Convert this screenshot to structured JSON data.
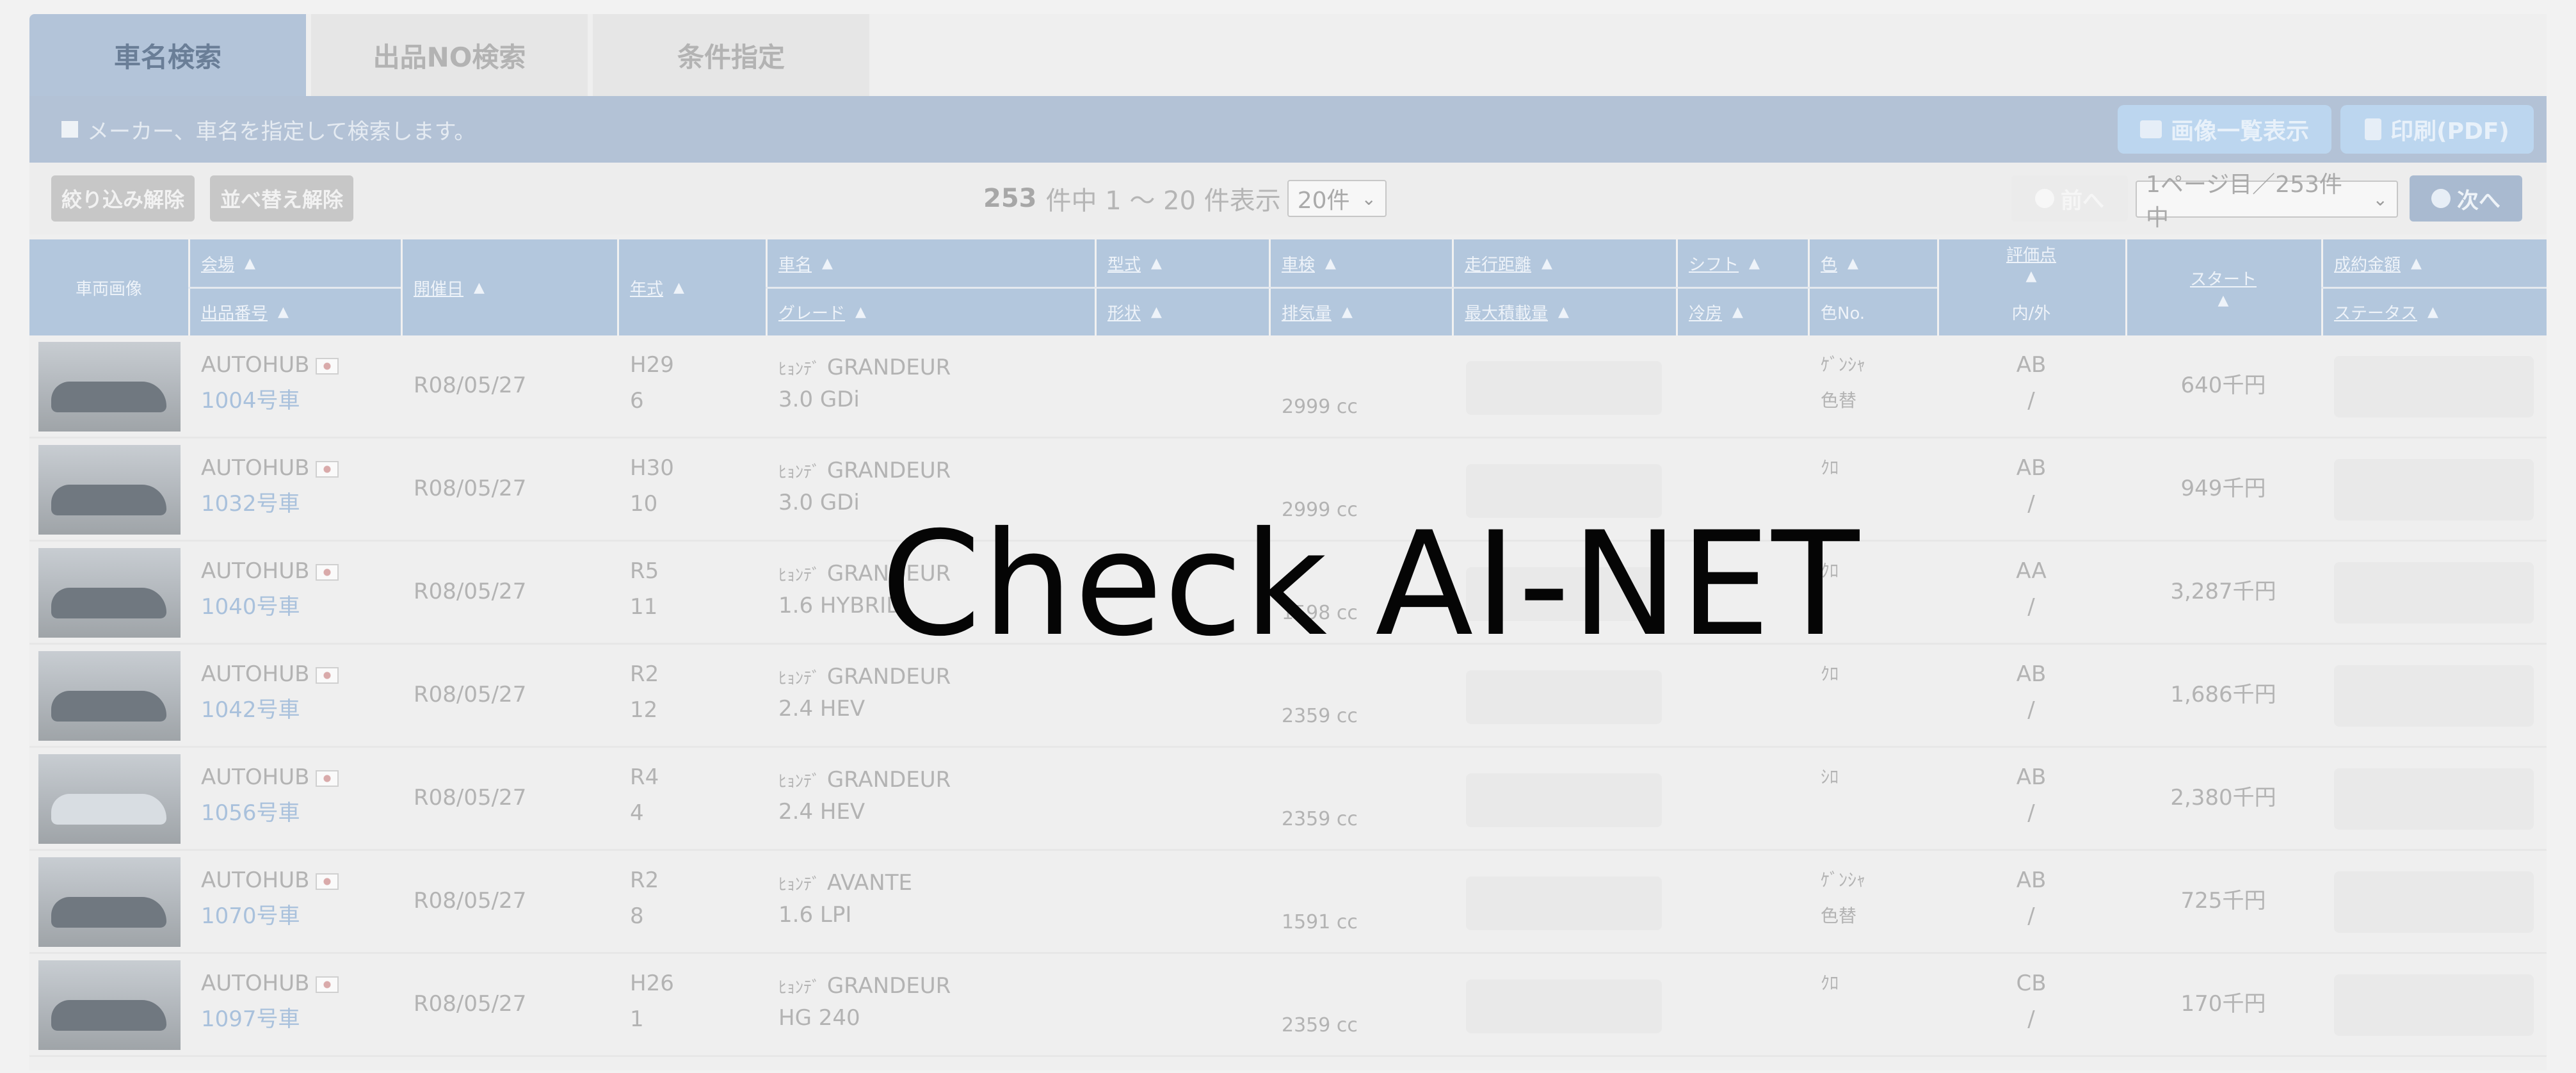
{
  "tabs": [
    {
      "label": "車名検索",
      "active": true
    },
    {
      "label": "出品NO検索",
      "active": false
    },
    {
      "label": "条件指定",
      "active": false
    }
  ],
  "infobar": {
    "text": "メーカー、車名を指定して検索します。",
    "image_list_label": "画像一覧表示",
    "print_label": "印刷(PDF)"
  },
  "controls": {
    "clear_filter_label": "絞り込み解除",
    "clear_sort_label": "並べ替え解除",
    "total": "253",
    "count_suffix": "件中 1 ～ 20 件表示",
    "per_page_value": "20件",
    "prev_label": "前へ",
    "page_value": "1ページ目／253件中",
    "next_label": "次へ"
  },
  "headers": {
    "image": "車両画像",
    "venue": "会場",
    "lot_no": "出品番号",
    "date": "開催日",
    "year": "年式",
    "car_name": "車名",
    "grade": "グレード",
    "model": "型式",
    "shape": "形状",
    "inspection": "車検",
    "displacement": "排気量",
    "mileage": "走行距離",
    "max_load": "最大積載量",
    "shift": "シフト",
    "cooling": "冷房",
    "color": "色",
    "color_no": "色No.",
    "score": "評価点",
    "int_ext": "内/外",
    "start": "スタート",
    "final_price": "成約金額",
    "status": "ステータス"
  },
  "rows": [
    {
      "venue": "AUTOHUB",
      "lot": "1004号車",
      "date": "R08/05/27",
      "era": "H29",
      "month": "6",
      "maker": "ﾋｮﾝﾃﾞ",
      "name": "GRANDEUR",
      "grade": "3.0 GDi",
      "cc": "2999 cc",
      "color1": "ｹﾞﾝｼｬ",
      "color2": "色替",
      "score": "AB",
      "ie": "/",
      "start": "640千円",
      "car_tone": "dark"
    },
    {
      "venue": "AUTOHUB",
      "lot": "1032号車",
      "date": "R08/05/27",
      "era": "H30",
      "month": "10",
      "maker": "ﾋｮﾝﾃﾞ",
      "name": "GRANDEUR",
      "grade": "3.0 GDi",
      "cc": "2999 cc",
      "color1": "ｸﾛ",
      "color2": "",
      "score": "AB",
      "ie": "/",
      "start": "949千円",
      "car_tone": "dark"
    },
    {
      "venue": "AUTOHUB",
      "lot": "1040号車",
      "date": "R08/05/27",
      "era": "R5",
      "month": "11",
      "maker": "ﾋｮﾝﾃﾞ",
      "name": "GRANDEUR",
      "grade": "1.6 HYBRID",
      "cc": "1598 cc",
      "color1": "ｸﾛ",
      "color2": "",
      "score": "AA",
      "ie": "/",
      "start": "3,287千円",
      "car_tone": "dark"
    },
    {
      "venue": "AUTOHUB",
      "lot": "1042号車",
      "date": "R08/05/27",
      "era": "R2",
      "month": "12",
      "maker": "ﾋｮﾝﾃﾞ",
      "name": "GRANDEUR",
      "grade": "2.4 HEV",
      "cc": "2359 cc",
      "color1": "ｸﾛ",
      "color2": "",
      "score": "AB",
      "ie": "/",
      "start": "1,686千円",
      "car_tone": "dark"
    },
    {
      "venue": "AUTOHUB",
      "lot": "1056号車",
      "date": "R08/05/27",
      "era": "R4",
      "month": "4",
      "maker": "ﾋｮﾝﾃﾞ",
      "name": "GRANDEUR",
      "grade": "2.4 HEV",
      "cc": "2359 cc",
      "color1": "ｼﾛ",
      "color2": "",
      "score": "AB",
      "ie": "/",
      "start": "2,380千円",
      "car_tone": "white"
    },
    {
      "venue": "AUTOHUB",
      "lot": "1070号車",
      "date": "R08/05/27",
      "era": "R2",
      "month": "8",
      "maker": "ﾋｮﾝﾃﾞ",
      "name": "AVANTE",
      "grade": "1.6 LPI",
      "cc": "1591 cc",
      "color1": "ｹﾞﾝｼｬ",
      "color2": "色替",
      "score": "AB",
      "ie": "/",
      "start": "725千円",
      "car_tone": "dark"
    },
    {
      "venue": "AUTOHUB",
      "lot": "1097号車",
      "date": "R08/05/27",
      "era": "H26",
      "month": "1",
      "maker": "ﾋｮﾝﾃﾞ",
      "name": "GRANDEUR",
      "grade": "HG 240",
      "cc": "2359 cc",
      "color1": "ｸﾛ",
      "color2": "",
      "score": "CB",
      "ie": "/",
      "start": "170千円",
      "car_tone": "dark"
    }
  ],
  "watermark": "Check AI-NET",
  "colors": {
    "header_blue": "#b3c7dd",
    "info_bar": "#b3c2d6",
    "link_blue": "#a9c1dc",
    "watermark": "#050505"
  }
}
